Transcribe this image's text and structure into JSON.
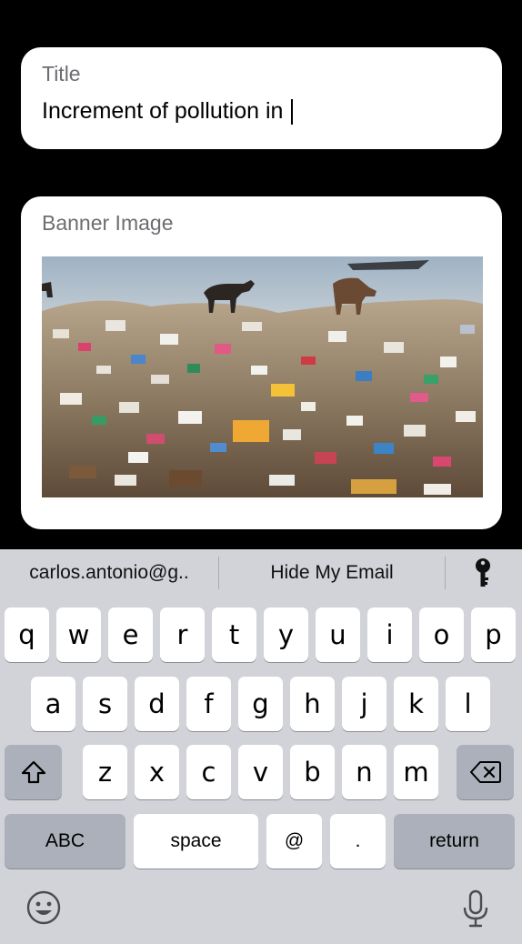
{
  "form": {
    "title_label": "Title",
    "title_value": "Increment of pollution in",
    "banner_label": "Banner Image"
  },
  "keyboard": {
    "suggestions": [
      "carlos.antonio@g..",
      "Hide My Email"
    ],
    "row1": [
      "q",
      "w",
      "e",
      "r",
      "t",
      "y",
      "u",
      "i",
      "o",
      "p"
    ],
    "row2": [
      "a",
      "s",
      "d",
      "f",
      "g",
      "h",
      "j",
      "k",
      "l"
    ],
    "row3": [
      "z",
      "x",
      "c",
      "v",
      "b",
      "n",
      "m"
    ],
    "abc_label": "ABC",
    "space_label": "space",
    "at_label": "@",
    "dot_label": ".",
    "return_label": "return"
  },
  "icons": {
    "key": "key-icon",
    "shift": "shift-icon",
    "backspace": "backspace-icon",
    "emoji": "emoji-icon",
    "microphone": "microphone-icon"
  },
  "colors": {
    "background": "#000000",
    "card": "#ffffff",
    "keyboard": "#d1d3d9",
    "key": "#ffffff",
    "function_key": "#abb0bb"
  }
}
